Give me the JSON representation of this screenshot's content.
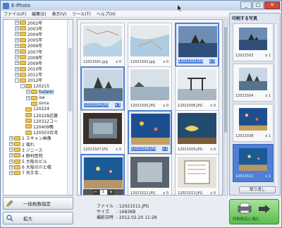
{
  "window": {
    "title": "E-Photo"
  },
  "menu": [
    "ファイル(F)",
    "編集(E)",
    "表示(V)",
    "ツール(T)",
    "ヘルプ(H)"
  ],
  "window_buttons": {
    "minimize": "_",
    "maximize": "□",
    "close": "✕"
  },
  "tree": [
    {
      "label": "2002年",
      "indent": 2,
      "exp": "+"
    },
    {
      "label": "2003年",
      "indent": 2,
      "exp": "+"
    },
    {
      "label": "2004年",
      "indent": 2,
      "exp": "+"
    },
    {
      "label": "2005年",
      "indent": 2,
      "exp": "+"
    },
    {
      "label": "2006年",
      "indent": 2,
      "exp": "+"
    },
    {
      "label": "2007年",
      "indent": 2,
      "exp": "+"
    },
    {
      "label": "2008年",
      "indent": 2,
      "exp": "+"
    },
    {
      "label": "2009年",
      "indent": 2,
      "exp": "+"
    },
    {
      "label": "2010年",
      "indent": 2,
      "exp": "+"
    },
    {
      "label": "2011年",
      "indent": 2,
      "exp": "+"
    },
    {
      "label": "2012年",
      "indent": 2,
      "exp": "-"
    },
    {
      "label": "120215",
      "indent": 3,
      "exp": "-"
    },
    {
      "label": "hutami",
      "indent": 4,
      "exp": "+",
      "sel": true
    },
    {
      "label": "ise",
      "indent": 4,
      "exp": "+"
    },
    {
      "label": "sima",
      "indent": 4,
      "exp": ""
    },
    {
      "label": "120224",
      "indent": 3,
      "exp": ""
    },
    {
      "label": "120228近畿",
      "indent": 3,
      "exp": ""
    },
    {
      "label": "120312コー",
      "indent": 3,
      "exp": ""
    },
    {
      "label": "120409鴨",
      "indent": 3,
      "exp": ""
    },
    {
      "label": "120503台湾",
      "indent": 3,
      "exp": ""
    },
    {
      "label": "1 スキャン画像",
      "indent": 1,
      "exp": "+"
    },
    {
      "label": "2 壊れ",
      "indent": 1,
      "exp": "+"
    },
    {
      "label": "3 ジニース",
      "indent": 1,
      "exp": "+"
    },
    {
      "label": "4 野村医院",
      "indent": 1,
      "exp": "+"
    },
    {
      "label": "5 大阪のビル",
      "indent": 1,
      "exp": "+"
    },
    {
      "label": "6 大阪の川と橋",
      "indent": 1,
      "exp": "+"
    },
    {
      "label": "7 天王寺...",
      "indent": 1,
      "exp": "+"
    }
  ],
  "grid": [
    {
      "name": "12021501.jpg",
      "count": "x 0",
      "kind": "map",
      "sel": false
    },
    {
      "name": "12021502.jpg",
      "count": "x 0",
      "kind": "map2",
      "sel": false
    },
    {
      "name": "12021503.JPG",
      "count": "x 1",
      "kind": "sea",
      "sel": true
    },
    {
      "name": "12021504.JPG",
      "count": "x 1",
      "kind": "rock",
      "sel": true
    },
    {
      "name": "12021505.JPG",
      "count": "x 0",
      "kind": "shore",
      "sel": false
    },
    {
      "name": "12021506.JPG",
      "count": "x 0",
      "kind": "torii",
      "sel": false
    },
    {
      "name": "12021507.JPG",
      "count": "x 0",
      "kind": "aquarium",
      "sel": false
    },
    {
      "name": "12021508.JPG",
      "count": "x 1",
      "kind": "tank",
      "sel": true
    },
    {
      "name": "12021509.JPG",
      "count": "x 0",
      "kind": "fish",
      "sel": false
    },
    {
      "name": "",
      "count": "",
      "kind": "tank2",
      "sel": true,
      "qty": "1"
    },
    {
      "name": "12021512.JPG",
      "count": "x 0",
      "kind": "glass",
      "sel": false
    },
    {
      "name": "12021513.JPG",
      "count": "x 0",
      "kind": "panel",
      "sel": false
    }
  ],
  "print_panel": {
    "title": "印刷する写真",
    "items": [
      {
        "name": "12021503",
        "count": "x 1",
        "kind": "sea",
        "sel": false
      },
      {
        "name": "12021504",
        "count": "x 1",
        "kind": "rock",
        "sel": false
      },
      {
        "name": "12021508",
        "count": "x 1",
        "kind": "tank",
        "sel": false
      },
      {
        "name": "12021511",
        "count": "x 1",
        "kind": "tank2",
        "sel": true
      }
    ],
    "remove_label": "取り消し"
  },
  "buttons": {
    "bulk_label": "一括枚数指定",
    "zoom_label": "拡大",
    "go_label": "印刷設定に進む"
  },
  "info": {
    "file_key": "ファイル",
    "file_val": ": 12021511.JPG",
    "size_key": "サイズ",
    "size_val": ": 1683KB",
    "date_key": "撮影日時",
    "date_val": ": 2012.02.20 11:28"
  },
  "colors": {
    "accent": "#4f7fd6",
    "go_green": "#5dbc4c"
  }
}
